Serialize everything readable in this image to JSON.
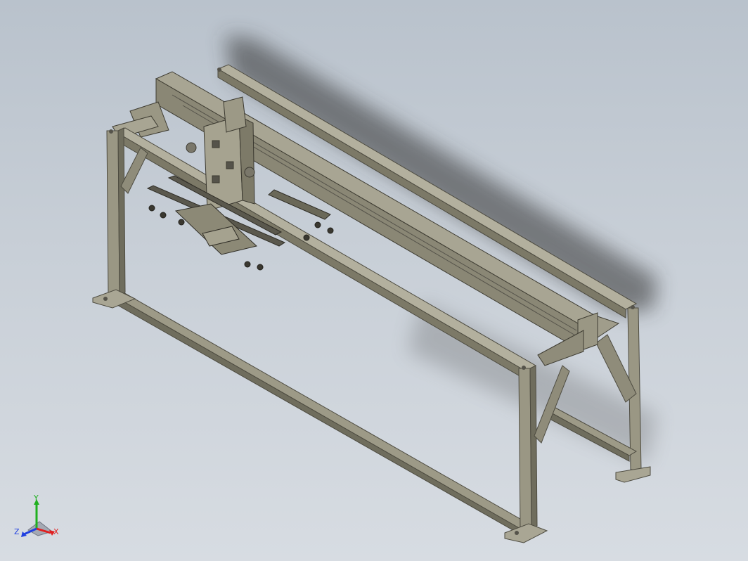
{
  "viewport": {
    "background_top": "#b9c2cc",
    "background_bottom": "#d7dce2"
  },
  "model": {
    "description_icon": "gantry-assembly-icon",
    "steel_color": "#8f8c7a",
    "steel_dark": "#5f5d4f",
    "steel_light": "#b7b4a2"
  },
  "triad": {
    "x_label": "X",
    "y_label": "Y",
    "z_label": "Z",
    "x_color": "#e02020",
    "y_color": "#20b020",
    "z_color": "#2040e0"
  }
}
